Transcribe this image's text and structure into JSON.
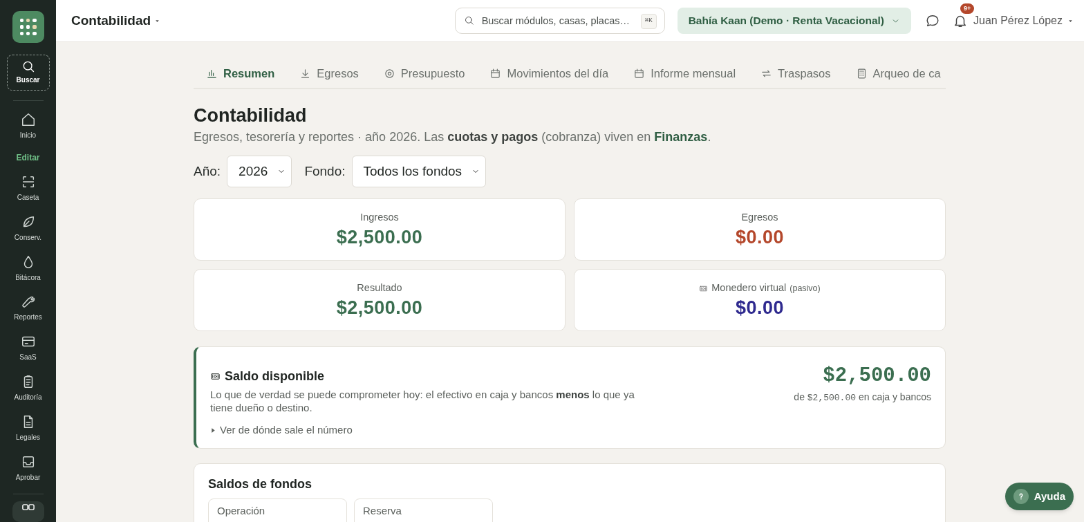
{
  "sidebar": {
    "search_label": "Buscar",
    "items": [
      {
        "kind": "link",
        "label": "Inicio"
      },
      {
        "kind": "section",
        "label": "Editar"
      },
      {
        "kind": "link",
        "label": "Caseta"
      },
      {
        "kind": "link",
        "label": "Conserv."
      },
      {
        "kind": "link",
        "label": "Bitácora"
      },
      {
        "kind": "link",
        "label": "Reportes"
      },
      {
        "kind": "link",
        "label": "SaaS"
      },
      {
        "kind": "link",
        "label": "Auditoría"
      },
      {
        "kind": "link",
        "label": "Legales"
      },
      {
        "kind": "link",
        "label": "Aprobar"
      }
    ]
  },
  "header": {
    "title": "Contabilidad",
    "search": {
      "placeholder": "Buscar módulos, casas, placas…",
      "shortcut": "⌘K"
    },
    "organization": "Bahía Kaan (Demo · Renta Vacacional)",
    "notifications_badge": "9+",
    "user": "Juan Pérez López"
  },
  "tabs": [
    {
      "label": "Resumen",
      "selected": true
    },
    {
      "label": "Egresos",
      "selected": false
    },
    {
      "label": "Presupuesto",
      "selected": false
    },
    {
      "label": "Movimientos del día",
      "selected": false
    },
    {
      "label": "Informe mensual",
      "selected": false
    },
    {
      "label": "Traspasos",
      "selected": false
    },
    {
      "label": "Arqueo de ca",
      "selected": false
    }
  ],
  "page": {
    "title": "Contabilidad",
    "subtitle": "Egresos, tesorería y reportes · año 2026. Las **cuotas y pagos** (cobranza) viven en ",
    "subtitle_link": "Finanzas",
    "subtitle_end": "."
  },
  "filters": [
    {
      "label": "Año:",
      "value": "2026"
    },
    {
      "label": "Fondo:",
      "value": "Todos los fondos"
    }
  ],
  "summary_cards": [
    {
      "label": "Ingresos",
      "amount": "$2,500.00",
      "color": "#3b6e50"
    },
    {
      "label": "Egresos",
      "amount": "$0.00",
      "color": "#b4472b"
    },
    {
      "label": "Resultado",
      "amount": "$2,500.00",
      "color": "#3b6e50"
    },
    {
      "label": "Monedero virtual",
      "note": "(pasivo)",
      "amount": "$0.00",
      "color": "#2f2a8f"
    }
  ],
  "available_balance": {
    "title": "Saldo disponible",
    "description": "Lo que de verdad se puede comprometer hoy: el efectivo en caja y bancos **menos** lo que ya tiene dueño o destino.",
    "details_toggle": "Ver de dónde sale el número",
    "expanded": false,
    "amount": "$2,500.00",
    "sub_prefix": "de",
    "sub_amount": "$2,500.00",
    "sub_suffix": "en caja y bancos"
  },
  "fund_balances": {
    "title": "Saldos de fondos",
    "funds": [
      "Operación",
      "Reserva"
    ]
  },
  "help_button": "Ayuda"
}
